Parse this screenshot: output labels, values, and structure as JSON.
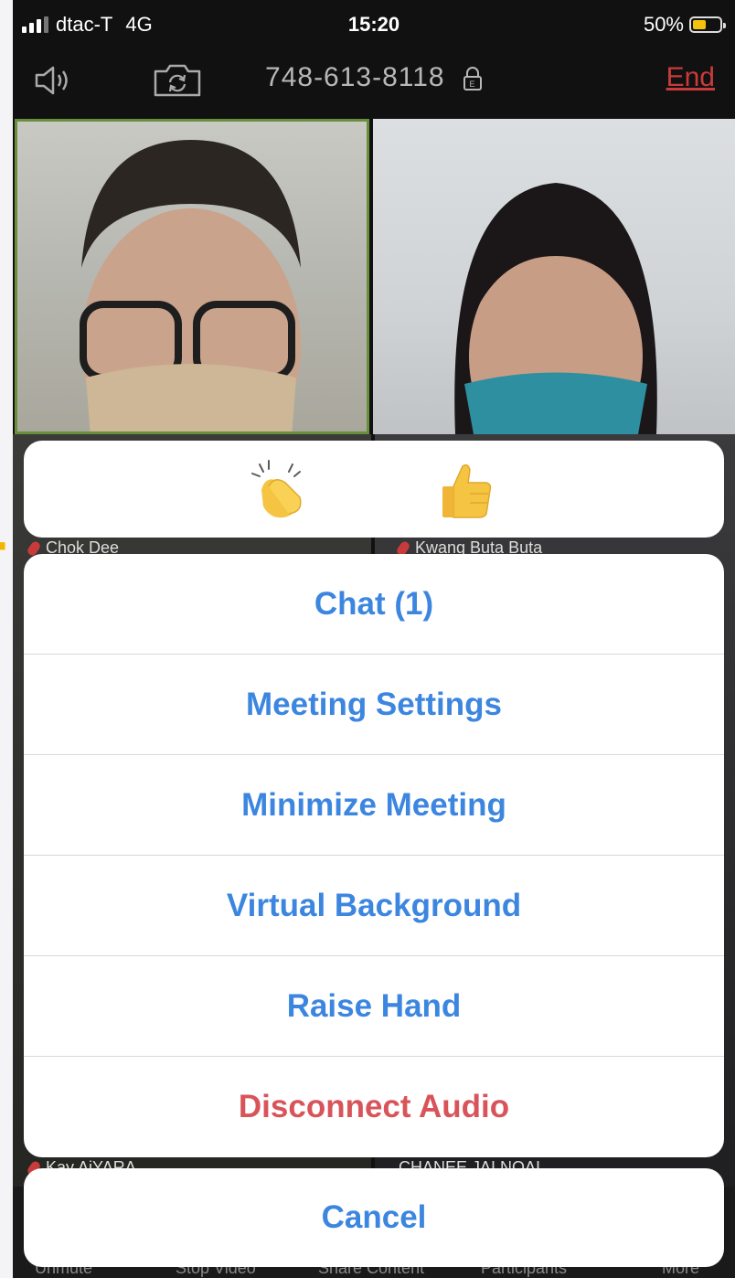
{
  "status_bar": {
    "carrier": "dtac-T",
    "network": "4G",
    "time": "15:20",
    "battery_percent": "50%",
    "battery_level": 0.5
  },
  "meeting": {
    "id": "748-613-8118",
    "end_label": "End",
    "icons": [
      "speaker-icon",
      "camera-flip-icon",
      "lock-icon"
    ]
  },
  "participants": [
    {
      "name": "Chok Dee",
      "muted": true
    },
    {
      "name": "Kwang Buta Buta",
      "muted": true
    },
    {
      "name": "Kay AiYARA",
      "muted": true
    },
    {
      "name": "CHANEE JAI NOAI",
      "muted": false
    }
  ],
  "reactions": [
    "👏",
    "👍"
  ],
  "actions": [
    {
      "label": "Chat (1)",
      "style": "default"
    },
    {
      "label": "Meeting Settings",
      "style": "default"
    },
    {
      "label": "Minimize Meeting",
      "style": "default"
    },
    {
      "label": "Virtual Background",
      "style": "default"
    },
    {
      "label": "Raise Hand",
      "style": "default"
    },
    {
      "label": "Disconnect Audio",
      "style": "destructive"
    }
  ],
  "cancel_label": "Cancel",
  "toolbar": [
    "Unmute",
    "Stop Video",
    "Share Content",
    "Participants",
    "More"
  ],
  "colors": {
    "action_blue": "#3c86e0",
    "destructive_red": "#d8545a",
    "end_red": "#c93b3b",
    "active_speaker_border": "#6a8f3c"
  }
}
